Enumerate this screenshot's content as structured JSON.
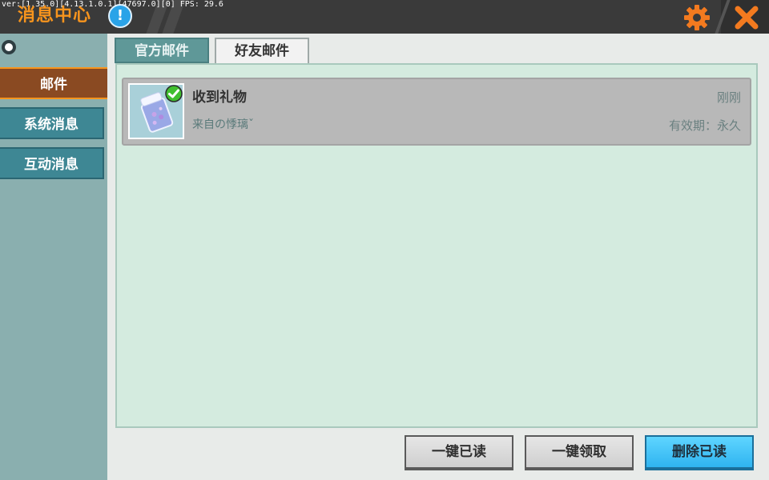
{
  "debug_text": "ver:[1.35.0][4.13.1.0.1][47697.0][0] FPS: 29.6",
  "header": {
    "title": "消息中心",
    "info_icon": "!",
    "settings_icon": "gear-icon",
    "close_icon": "close-icon",
    "accent_color": "#f7941d"
  },
  "sidebar": {
    "items": [
      {
        "label": "邮件",
        "active": true
      },
      {
        "label": "系统消息",
        "active": false
      },
      {
        "label": "互动消息",
        "active": false
      }
    ]
  },
  "tabs": [
    {
      "label": "官方邮件",
      "active": false
    },
    {
      "label": "好友邮件",
      "active": true
    }
  ],
  "mail_list": [
    {
      "icon": "gift-pack-icon",
      "claimed": true,
      "title": "收到礼物",
      "from": "来自の悸璃ˇ",
      "time": "刚刚",
      "expiry": "有效期：永久"
    }
  ],
  "actions": {
    "read_all": "一键已读",
    "claim_all": "一键领取",
    "delete_read": "删除已读"
  }
}
